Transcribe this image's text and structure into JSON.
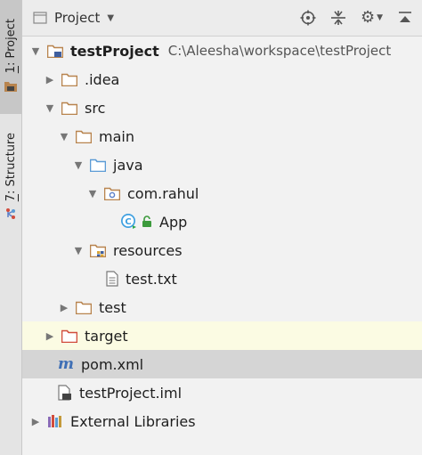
{
  "side_tabs": {
    "project": {
      "num": "1",
      "label": ": Project"
    },
    "structure": {
      "num": "7",
      "label": ": Structure"
    }
  },
  "toolbar": {
    "selector_label": "Project"
  },
  "colors": {
    "folder_tan": "#b8844e",
    "folder_blue": "#5b9bd5",
    "folder_red": "#d14c3c",
    "highlight_yellow": "#fbfbe3",
    "highlight_selected": "#d5d5d5"
  },
  "tree": {
    "root": {
      "label": "testProject",
      "path": "C:\\Aleesha\\workspace\\testProject"
    },
    "idea": {
      "label": ".idea"
    },
    "src": {
      "label": "src"
    },
    "main": {
      "label": "main"
    },
    "java": {
      "label": "java"
    },
    "package": {
      "label": "com.rahul"
    },
    "app": {
      "label": "App"
    },
    "resources": {
      "label": "resources"
    },
    "test_txt": {
      "label": "test.txt"
    },
    "test": {
      "label": "test"
    },
    "target": {
      "label": "target"
    },
    "pom": {
      "label": "pom.xml"
    },
    "iml": {
      "label": "testProject.iml"
    },
    "ext_libs": {
      "label": "External Libraries"
    }
  }
}
